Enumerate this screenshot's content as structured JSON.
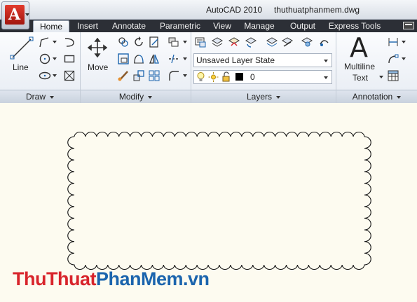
{
  "window": {
    "app_title": "AutoCAD 2010",
    "file_name": "thuthuatphanmem.dwg",
    "app_button_letter": "A"
  },
  "tabs": [
    {
      "label": "Home",
      "active": true
    },
    {
      "label": "Insert"
    },
    {
      "label": "Annotate"
    },
    {
      "label": "Parametric"
    },
    {
      "label": "View"
    },
    {
      "label": "Manage"
    },
    {
      "label": "Output"
    },
    {
      "label": "Express Tools"
    }
  ],
  "panels": {
    "draw": {
      "title": "Draw",
      "line_label": "Line"
    },
    "modify": {
      "title": "Modify",
      "move_label": "Move"
    },
    "layers": {
      "title": "Layers",
      "layer_state_value": "Unsaved Layer State",
      "current_layer_value": "0"
    },
    "annotation": {
      "title": "Annotation",
      "multiline_label_1": "Multiline",
      "multiline_label_2": "Text",
      "big_letter": "A"
    }
  },
  "watermark": {
    "part1": "Thu",
    "part2": "Thuat",
    "part3": "Phan",
    "part4": "Mem",
    "part5": ".vn"
  },
  "colors": {
    "accent_red": "#d8242b",
    "accent_blue": "#1b64ad",
    "canvas_bg": "#fdfbf0",
    "ribbon_tabs_bg": "#2c2f36"
  }
}
